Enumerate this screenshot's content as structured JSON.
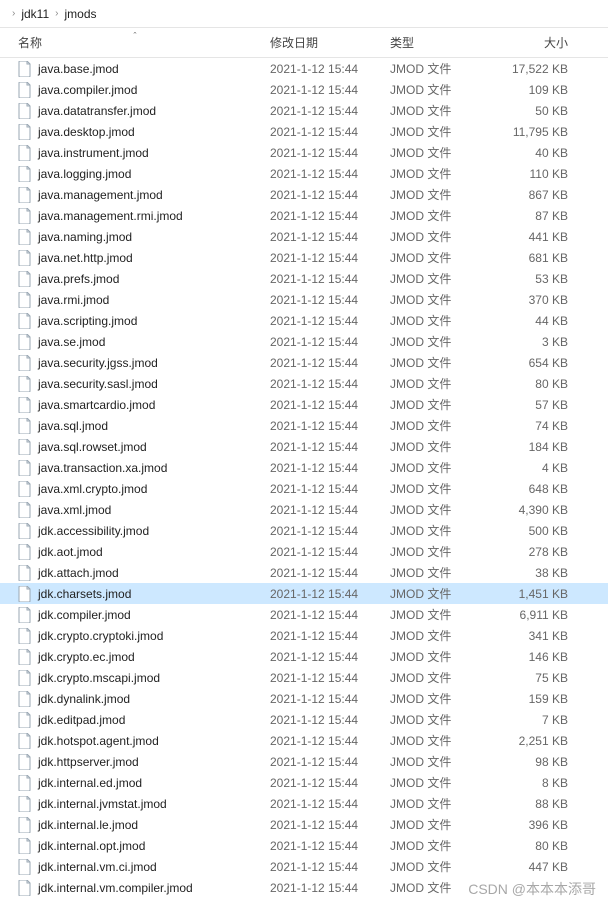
{
  "breadcrumb": {
    "parent": "jdk11",
    "current": "jmods"
  },
  "headers": {
    "name": "名称",
    "date": "修改日期",
    "type": "类型",
    "size": "大小",
    "sort_indicator": "ˆ"
  },
  "common": {
    "date": "2021-1-12 15:44",
    "type": "JMOD 文件"
  },
  "selected_index": 25,
  "files": [
    {
      "name": "java.base.jmod",
      "size": "17,522 KB"
    },
    {
      "name": "java.compiler.jmod",
      "size": "109 KB"
    },
    {
      "name": "java.datatransfer.jmod",
      "size": "50 KB"
    },
    {
      "name": "java.desktop.jmod",
      "size": "11,795 KB"
    },
    {
      "name": "java.instrument.jmod",
      "size": "40 KB"
    },
    {
      "name": "java.logging.jmod",
      "size": "110 KB"
    },
    {
      "name": "java.management.jmod",
      "size": "867 KB"
    },
    {
      "name": "java.management.rmi.jmod",
      "size": "87 KB"
    },
    {
      "name": "java.naming.jmod",
      "size": "441 KB"
    },
    {
      "name": "java.net.http.jmod",
      "size": "681 KB"
    },
    {
      "name": "java.prefs.jmod",
      "size": "53 KB"
    },
    {
      "name": "java.rmi.jmod",
      "size": "370 KB"
    },
    {
      "name": "java.scripting.jmod",
      "size": "44 KB"
    },
    {
      "name": "java.se.jmod",
      "size": "3 KB"
    },
    {
      "name": "java.security.jgss.jmod",
      "size": "654 KB"
    },
    {
      "name": "java.security.sasl.jmod",
      "size": "80 KB"
    },
    {
      "name": "java.smartcardio.jmod",
      "size": "57 KB"
    },
    {
      "name": "java.sql.jmod",
      "size": "74 KB"
    },
    {
      "name": "java.sql.rowset.jmod",
      "size": "184 KB"
    },
    {
      "name": "java.transaction.xa.jmod",
      "size": "4 KB"
    },
    {
      "name": "java.xml.crypto.jmod",
      "size": "648 KB"
    },
    {
      "name": "java.xml.jmod",
      "size": "4,390 KB"
    },
    {
      "name": "jdk.accessibility.jmod",
      "size": "500 KB"
    },
    {
      "name": "jdk.aot.jmod",
      "size": "278 KB"
    },
    {
      "name": "jdk.attach.jmod",
      "size": "38 KB"
    },
    {
      "name": "jdk.charsets.jmod",
      "size": "1,451 KB"
    },
    {
      "name": "jdk.compiler.jmod",
      "size": "6,911 KB"
    },
    {
      "name": "jdk.crypto.cryptoki.jmod",
      "size": "341 KB"
    },
    {
      "name": "jdk.crypto.ec.jmod",
      "size": "146 KB"
    },
    {
      "name": "jdk.crypto.mscapi.jmod",
      "size": "75 KB"
    },
    {
      "name": "jdk.dynalink.jmod",
      "size": "159 KB"
    },
    {
      "name": "jdk.editpad.jmod",
      "size": "7 KB"
    },
    {
      "name": "jdk.hotspot.agent.jmod",
      "size": "2,251 KB"
    },
    {
      "name": "jdk.httpserver.jmod",
      "size": "98 KB"
    },
    {
      "name": "jdk.internal.ed.jmod",
      "size": "8 KB"
    },
    {
      "name": "jdk.internal.jvmstat.jmod",
      "size": "88 KB"
    },
    {
      "name": "jdk.internal.le.jmod",
      "size": "396 KB"
    },
    {
      "name": "jdk.internal.opt.jmod",
      "size": "80 KB"
    },
    {
      "name": "jdk.internal.vm.ci.jmod",
      "size": "447 KB"
    },
    {
      "name": "jdk.internal.vm.compiler.jmod",
      "size": ""
    }
  ],
  "watermark": "CSDN @本本本添哥"
}
